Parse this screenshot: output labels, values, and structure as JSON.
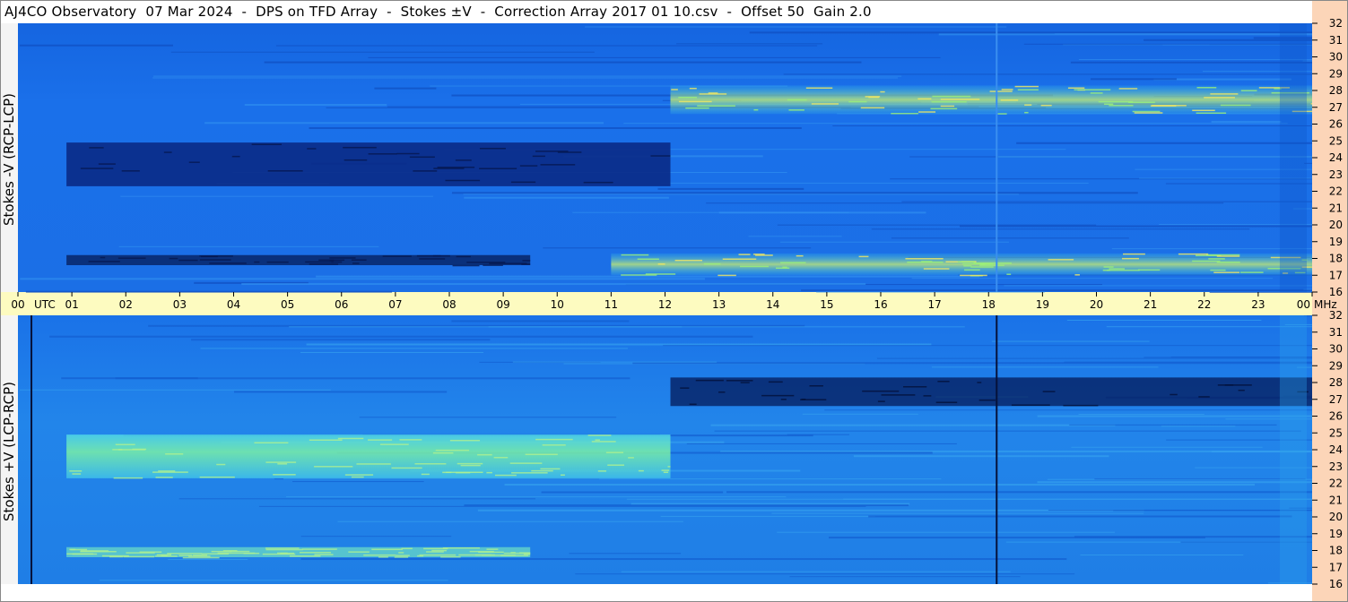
{
  "title": "AJ4CO Observatory  07 Mar 2024  -  DPS on TFD Array  -  Stokes ±V  -  Correction Array 2017 01 10.csv  -  Offset 50  Gain 2.0",
  "chart_data": {
    "type": "heatmap",
    "title": "AJ4CO Observatory  07 Mar 2024  -  DPS on TFD Array  -  Stokes ±V  -  Correction Array 2017 01 10.csv  -  Offset 50  Gain 2.0",
    "xlabel": "UTC",
    "ylabel_unit": "MHz",
    "x_ticks": [
      "00",
      "01",
      "02",
      "03",
      "04",
      "05",
      "06",
      "07",
      "08",
      "09",
      "10",
      "11",
      "12",
      "13",
      "14",
      "15",
      "16",
      "17",
      "18",
      "19",
      "20",
      "21",
      "22",
      "23",
      "00"
    ],
    "y_ticks": [
      32,
      31,
      30,
      29,
      28,
      27,
      26,
      25,
      24,
      23,
      22,
      21,
      20,
      19,
      18,
      17,
      16
    ],
    "xlim_hours": [
      0,
      24
    ],
    "ylim_mhz": [
      16,
      32
    ],
    "panels": [
      {
        "label": "Stokes -V (RCP-LCP)",
        "base_color": "#1a6ee8",
        "features": [
          {
            "kind": "dark_block",
            "t": [
              0.9,
              12.1
            ],
            "f": [
              22.3,
              24.9
            ]
          },
          {
            "kind": "dark_band",
            "t": [
              0.9,
              9.5
            ],
            "f": [
              17.6,
              18.2
            ]
          },
          {
            "kind": "bright_band",
            "t": [
              12.1,
              24
            ],
            "f": [
              26.6,
              28.3
            ]
          },
          {
            "kind": "bright_band",
            "t": [
              11.0,
              24
            ],
            "f": [
              17.0,
              18.3
            ]
          },
          {
            "kind": "vertical_line",
            "t": 18.15
          }
        ]
      },
      {
        "label": "Stokes +V (LCP-RCP)",
        "base_color": "#1e78e6",
        "features": [
          {
            "kind": "bright_block",
            "t": [
              0.9,
              12.1
            ],
            "f": [
              22.3,
              24.9
            ]
          },
          {
            "kind": "bright_band",
            "t": [
              0.9,
              9.5
            ],
            "f": [
              17.6,
              18.2
            ]
          },
          {
            "kind": "dark_band",
            "t": [
              12.1,
              24
            ],
            "f": [
              26.6,
              28.3
            ]
          },
          {
            "kind": "vertical_line",
            "t": 18.15
          },
          {
            "kind": "vertical_line",
            "t": 0.25
          }
        ]
      }
    ]
  }
}
